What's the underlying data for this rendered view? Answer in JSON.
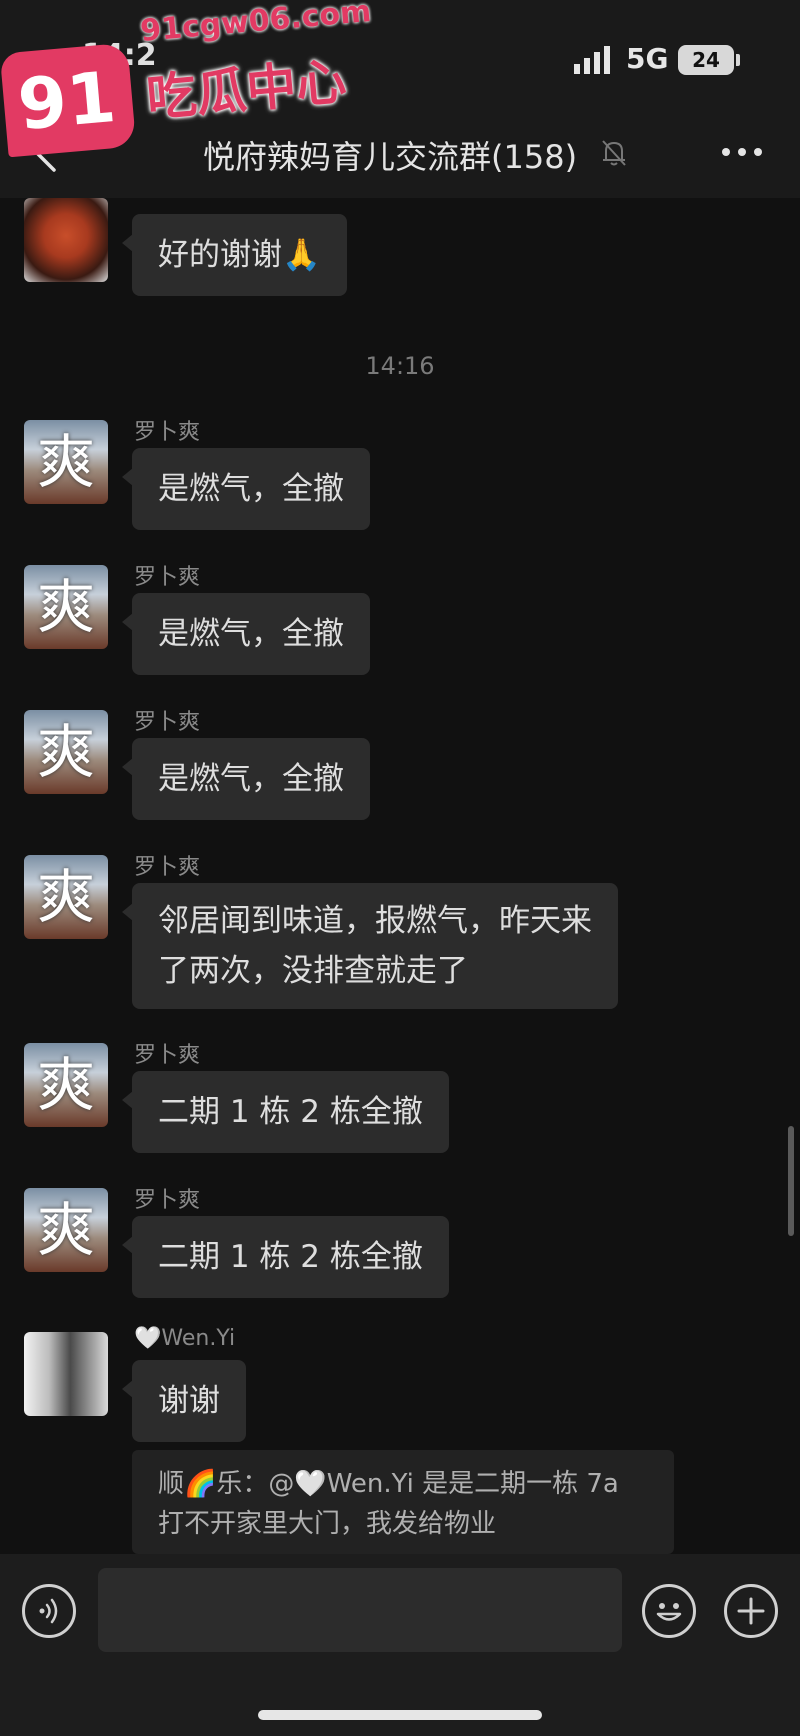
{
  "status_bar": {
    "time": "14:2",
    "network": "5G",
    "battery": "24"
  },
  "watermark": {
    "logo_number": "91",
    "domain": "91cgw06.com",
    "title": "吃瓜中心"
  },
  "header": {
    "title": "悦府辣妈育儿交流群(158)"
  },
  "messages": {
    "m0": {
      "text": "好的谢谢🙏"
    },
    "time_divider": "14:16",
    "m1": {
      "sender": "罗卜爽",
      "text": "是燃气，全撤"
    },
    "m2": {
      "sender": "罗卜爽",
      "text": "是燃气，全撤"
    },
    "m3": {
      "sender": "罗卜爽",
      "text": "是燃气，全撤"
    },
    "m4": {
      "sender": "罗卜爽",
      "line1": "邻居闻到味道，报燃气，昨天来",
      "line2": "了两次，没排查就走了"
    },
    "m5": {
      "sender": "罗卜爽",
      "text": "二期 1 栋 2 栋全撤"
    },
    "m6": {
      "sender": "罗卜爽",
      "text": "二期 1 栋 2 栋全撤"
    },
    "m7": {
      "sender": "🤍Wen.Yi",
      "text": "谢谢"
    },
    "quote": {
      "line1": "顺🌈乐：@🤍Wen.Yi 是是二期一栋 7a",
      "line2": "打不开家里大门，我发给物业"
    }
  },
  "avatar_glyph": "爽",
  "colors": {
    "background": "#111111",
    "bubble": "#2c2c2c",
    "input_bar": "#1d1d1d",
    "watermark": "#e23a63"
  }
}
